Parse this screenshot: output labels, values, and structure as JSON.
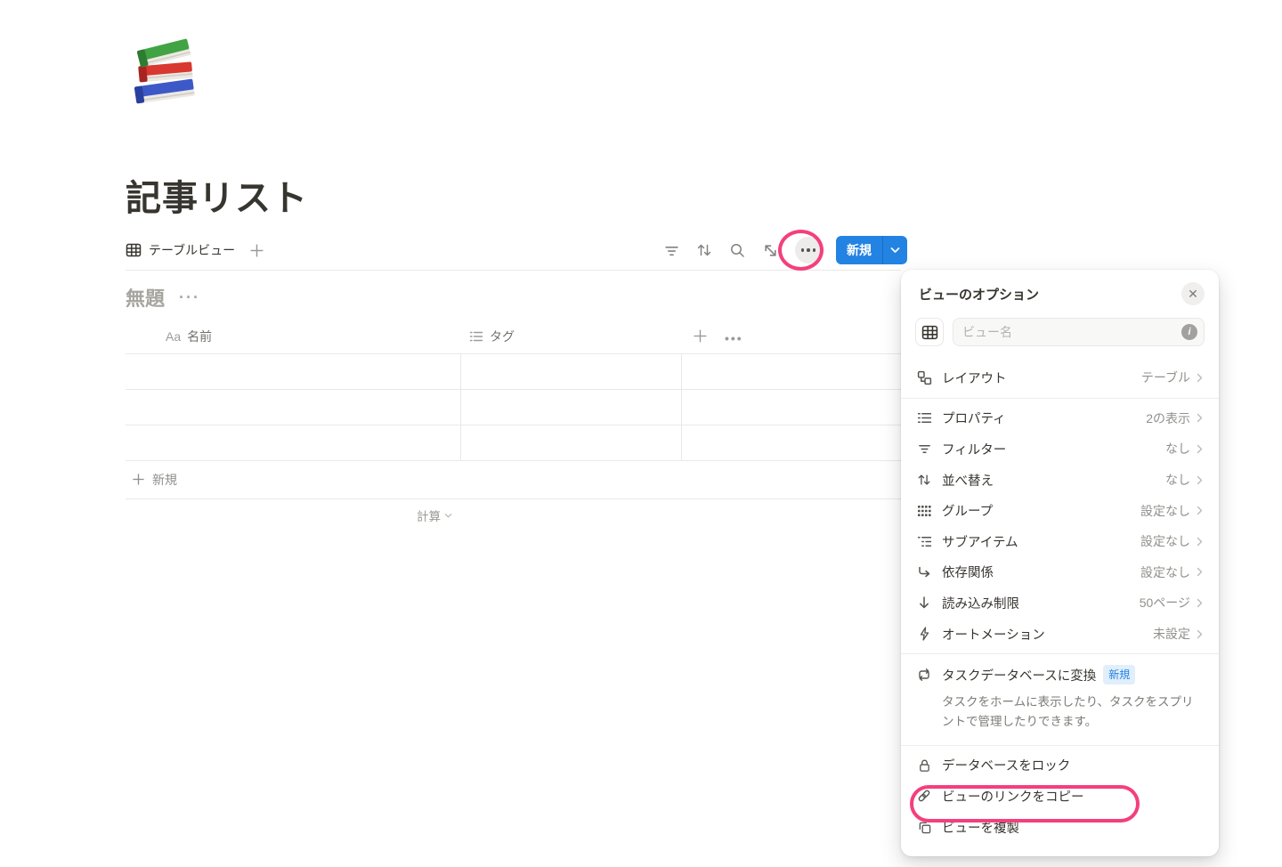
{
  "page": {
    "title": "記事リスト",
    "icon": "books"
  },
  "view_tab": {
    "label": "テーブルビュー"
  },
  "toolbar": {
    "new_label": "新規"
  },
  "table": {
    "title_placeholder": "無題",
    "more_dots": "···",
    "columns": [
      {
        "type": "Aa",
        "label": "名前"
      },
      {
        "type": "list",
        "label": "タグ"
      }
    ],
    "new_row_label": "新規",
    "calc_label": "計算"
  },
  "panel": {
    "title": "ビューのオプション",
    "view_name_placeholder": "ビュー名",
    "layout": {
      "label": "レイアウト",
      "value": "テーブル"
    },
    "settings": [
      {
        "label": "プロパティ",
        "value": "2の表示"
      },
      {
        "label": "フィルター",
        "value": "なし"
      },
      {
        "label": "並べ替え",
        "value": "なし"
      },
      {
        "label": "グループ",
        "value": "設定なし"
      },
      {
        "label": "サブアイテム",
        "value": "設定なし"
      },
      {
        "label": "依存関係",
        "value": "設定なし"
      },
      {
        "label": "読み込み制限",
        "value": "50ページ"
      },
      {
        "label": "オートメーション",
        "value": "未設定"
      }
    ],
    "convert": {
      "label": "タスクデータベースに変換",
      "badge": "新規",
      "description": "タスクをホームに表示したり、タスクをスプリントで管理したりできます。"
    },
    "actions": [
      {
        "label": "データベースをロック"
      },
      {
        "label": "ビューのリンクをコピー"
      },
      {
        "label": "ビューを複製"
      }
    ]
  },
  "colors": {
    "accent_blue": "#2383e2",
    "annotation_pink": "#f43f7d"
  }
}
